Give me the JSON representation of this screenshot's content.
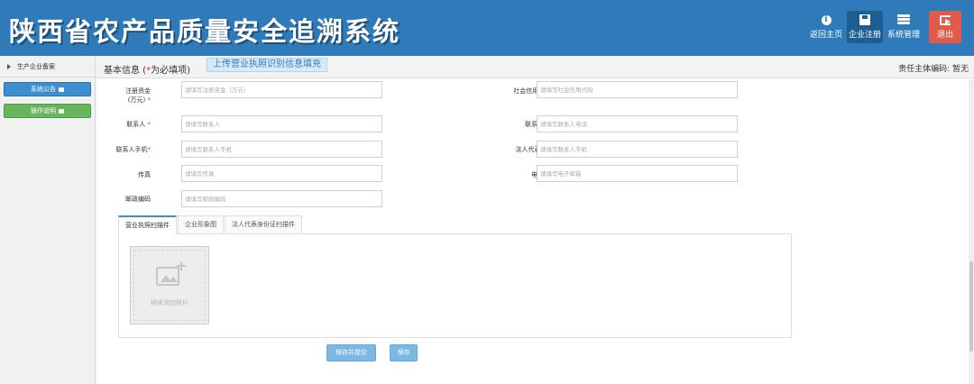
{
  "header": {
    "title": "陕西省农产品质量安全追溯系统",
    "actions": [
      {
        "label": "返回主页",
        "icon": "info-icon"
      },
      {
        "label": "企业注册",
        "icon": "save-icon"
      },
      {
        "label": "系统管理",
        "icon": "list-icon"
      },
      {
        "label": "退出",
        "icon": "logout-icon"
      }
    ]
  },
  "sidebar": {
    "menu_label": "生产企业备案",
    "notice_label": "系统公告",
    "guide_label": "操作说明"
  },
  "content_header": {
    "title_prefix": "基本信息 (",
    "title_star": "*",
    "title_suffix": "为必填项)",
    "upload_hint": "上传营业执照识别信息填充",
    "owner_code": "责任主体编码:  暂无"
  },
  "form": {
    "registered_capital": {
      "label": "注册资金",
      "sub": "(万元)",
      "required": "*",
      "placeholder": "请填写注册资金（万元）"
    },
    "credit_code": {
      "label": "社会信用代码",
      "required": "*",
      "placeholder": "请填写社会信用代码"
    },
    "contact": {
      "label": "联系人",
      "required": "*",
      "placeholder": "请填写联系人"
    },
    "contact_phone": {
      "label": "联系人电话",
      "placeholder": "请填写联系人电话"
    },
    "contact_mobile": {
      "label": "联系人手机",
      "required": "*",
      "placeholder": "请填写联系人手机"
    },
    "legal_mobile": {
      "label": "法人代表手机",
      "required": "*",
      "placeholder": "请填写联系人手机"
    },
    "fax": {
      "label": "传真",
      "placeholder": "请填写传真"
    },
    "email": {
      "label": "电子邮箱",
      "placeholder": "请填写电子邮箱"
    },
    "postcode": {
      "label": "邮政编码",
      "placeholder": "请填写邮政编码"
    }
  },
  "tabs": [
    {
      "label": "营业执照扫描件"
    },
    {
      "label": "企业形象图"
    },
    {
      "label": "法人代表身份证扫描件"
    }
  ],
  "upload_box": {
    "text": "继续添加照片"
  },
  "buttons": {
    "save_submit": "保存并提交",
    "save": "保存"
  },
  "colors": {
    "header_bg": "#2f7bb9",
    "required": "#e33333",
    "notice_button": "#3d8ed0",
    "guide_button": "#67b55f",
    "logout_button": "#e05b4b",
    "action_button": "#7bb8e3"
  }
}
